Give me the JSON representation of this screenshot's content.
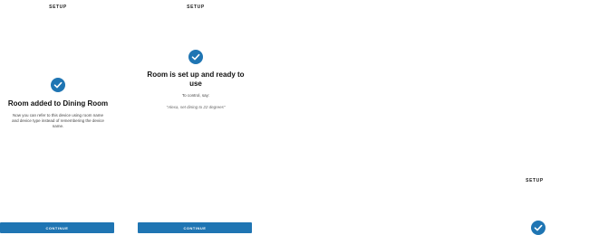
{
  "screens": [
    {
      "header": "SETUP",
      "title": "Room added to Dining Room",
      "body": "Now you can refer to this device using room name and device type instead of remembering the device name.",
      "button": "CONTINUE"
    },
    {
      "header": "SETUP",
      "title": "Room is set up and ready to use",
      "body": "To control, say:",
      "link": "\"Alexa, set dining to 22 degrees\"",
      "button": "CONTINUE"
    },
    {
      "header": "SETUP"
    }
  ],
  "colors": {
    "accent": "#1f75b3"
  },
  "icons": [
    "check-circle-icon"
  ]
}
